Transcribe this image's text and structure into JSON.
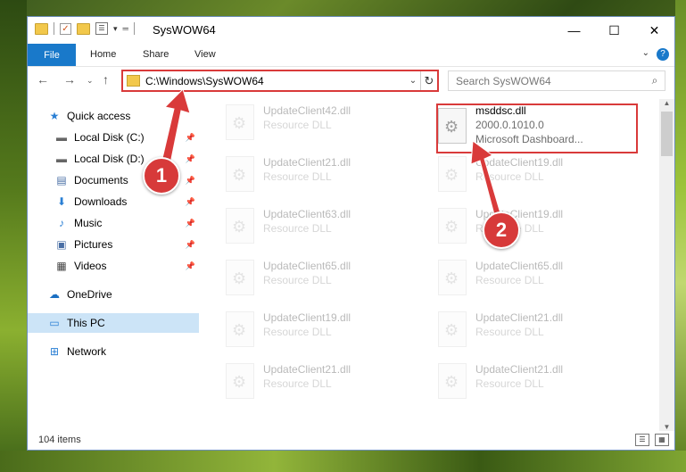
{
  "window": {
    "title": "SysWOW64",
    "controls": {
      "minimize": "—",
      "maximize": "☐",
      "close": "✕"
    }
  },
  "ribbon": {
    "file_label": "File",
    "tabs": [
      "Home",
      "Share",
      "View"
    ],
    "help": "?"
  },
  "navbar": {
    "address": "C:\\Windows\\SysWOW64",
    "search_placeholder": "Search SysWOW64"
  },
  "sidebar": {
    "items": [
      {
        "label": "Quick access",
        "icon": "star-icon",
        "pinned": false
      },
      {
        "label": "Local Disk (C:)",
        "icon": "drive-icon",
        "pinned": true
      },
      {
        "label": "Local Disk (D:)",
        "icon": "drive-icon",
        "pinned": true
      },
      {
        "label": "Documents",
        "icon": "documents-icon",
        "pinned": true
      },
      {
        "label": "Downloads",
        "icon": "download-icon",
        "pinned": true
      },
      {
        "label": "Music",
        "icon": "music-icon",
        "pinned": true
      },
      {
        "label": "Pictures",
        "icon": "pictures-icon",
        "pinned": true
      },
      {
        "label": "Videos",
        "icon": "videos-icon",
        "pinned": true
      },
      {
        "label": "OneDrive",
        "icon": "cloud-icon",
        "pinned": false
      },
      {
        "label": "This PC",
        "icon": "computer-icon",
        "pinned": false,
        "selected": true
      },
      {
        "label": "Network",
        "icon": "network-icon",
        "pinned": false
      }
    ]
  },
  "files": {
    "highlighted": {
      "name": "msddsc.dll",
      "version": "2000.0.1010.0",
      "description": "Microsoft Dashboard..."
    },
    "left_column": [
      {
        "name": "UpdateClient42.dll",
        "type": "Resource DLL"
      },
      {
        "name": "UpdateClient21.dll",
        "type": "Resource DLL"
      },
      {
        "name": "UpdateClient63.dll",
        "type": "Resource DLL"
      },
      {
        "name": "UpdateClient65.dll",
        "type": "Resource DLL"
      },
      {
        "name": "UpdateClient19.dll",
        "type": "Resource DLL"
      },
      {
        "name": "UpdateClient21.dll",
        "type": "Resource DLL"
      }
    ],
    "right_column": [
      {
        "name": "UpdateClient19.dll",
        "type": "Resource DLL"
      },
      {
        "name": "UpdateClient19.dll",
        "type": "Resource DLL"
      },
      {
        "name": "UpdateClient65.dll",
        "type": "Resource DLL"
      },
      {
        "name": "UpdateClient21.dll",
        "type": "Resource DLL"
      },
      {
        "name": "UpdateClient21.dll",
        "type": "Resource DLL"
      }
    ]
  },
  "status": {
    "item_count": "104 items"
  },
  "annotations": {
    "marker1": "1",
    "marker2": "2",
    "color": "#d93a3a"
  }
}
